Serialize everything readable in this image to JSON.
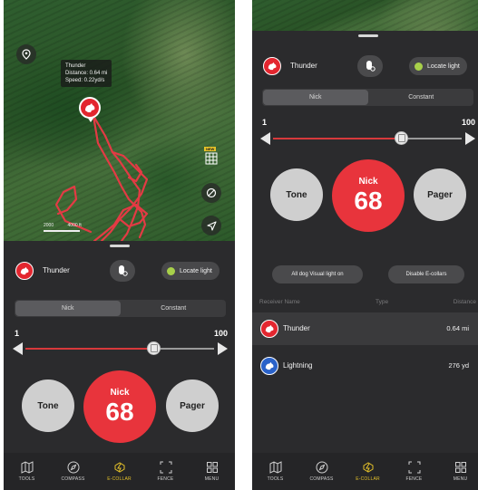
{
  "left_screen": {
    "map": {
      "tooltip": {
        "name": "Thunder",
        "distance": "Distance: 0.64 mi",
        "speed": "Speed: 0.22yd/s"
      },
      "scale_labels": [
        "2000",
        "4000 ft"
      ],
      "grid_tag": "NEW"
    },
    "dog": {
      "name": "Thunder",
      "locate_label": "Locate light"
    },
    "mode_tabs": [
      {
        "label": "Nick",
        "active": true
      },
      {
        "label": "Constant",
        "active": false
      }
    ],
    "level": {
      "min": "1",
      "max": "100",
      "value": 68,
      "fill_fraction": 0.68
    },
    "buttons": {
      "tone": "Tone",
      "nick_label": "Nick",
      "nick_value": "68",
      "pager": "Pager"
    }
  },
  "right_screen": {
    "dog": {
      "name": "Thunder",
      "locate_label": "Locate light"
    },
    "mode_tabs": [
      {
        "label": "Nick",
        "active": true
      },
      {
        "label": "Constant",
        "active": false
      }
    ],
    "level": {
      "min": "1",
      "max": "100",
      "value": 68,
      "fill_fraction": 0.68
    },
    "buttons": {
      "tone": "Tone",
      "nick_label": "Nick",
      "nick_value": "68",
      "pager": "Pager"
    },
    "actions": {
      "visual_light": "All dog Visual light on",
      "disable_collars": "Disable E-collars"
    },
    "table": {
      "headers": {
        "name": "Receiver Name",
        "type": "Type",
        "distance": "Distance"
      },
      "rows": [
        {
          "name": "Thunder",
          "distance": "0.64 mi",
          "avatar_color": "#e3262f",
          "highlight": true
        },
        {
          "name": "Lightning",
          "distance": "276 yd",
          "avatar_color": "#2a62c9",
          "highlight": false
        }
      ]
    }
  },
  "nav": [
    {
      "label": "TOOLS",
      "icon": "map-icon",
      "active": false
    },
    {
      "label": "COMPASS",
      "icon": "compass-icon",
      "active": false
    },
    {
      "label": "E-COLLAR",
      "icon": "e-collar-icon",
      "active": true
    },
    {
      "label": "FENCE",
      "icon": "fence-icon",
      "active": false
    },
    {
      "label": "MENU",
      "icon": "menu-grid-icon",
      "active": false
    }
  ],
  "colors": {
    "accent_red": "#e8343c",
    "active_nav": "#e6c229",
    "locate_dot": "#a8d04a",
    "panel_bg": "#2b2b2d"
  }
}
